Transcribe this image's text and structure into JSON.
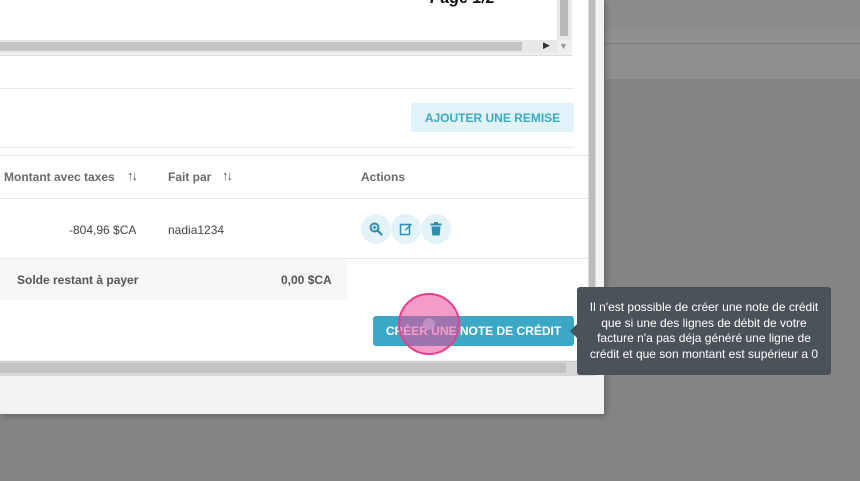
{
  "pdf": {
    "page_label": "Page 1/2"
  },
  "discount_button": {
    "label": "AJOUTER UNE REMISE"
  },
  "table": {
    "columns": [
      {
        "label": "Montant avec taxes"
      },
      {
        "label": "Fait par"
      },
      {
        "label": "Actions"
      }
    ],
    "rows": [
      {
        "amount": "-804,96 $CA",
        "by": "nadia1234",
        "actions": [
          "search-plus-icon",
          "edit-icon",
          "trash-icon"
        ]
      }
    ],
    "balance": {
      "label": "Solde restant à payer",
      "value": "0,00 $CA"
    }
  },
  "credit_button": {
    "label": "CRÉER UNE NOTE DE CRÉDIT"
  },
  "tooltip": {
    "text": "Il n'est possible de créer une note de crédit que si une des lignes de débit de votre facture n'a pas déja généré une ligne de crédit et que son montant est supérieur a 0"
  },
  "colors": {
    "accent": "#3da8c6",
    "accent_light": "#dff3f8",
    "tooltip_bg": "#4c525a",
    "cursor": "#e83e8c"
  }
}
